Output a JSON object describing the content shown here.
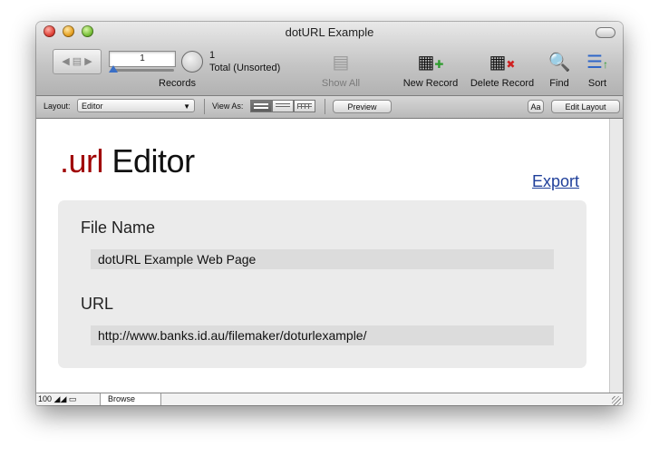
{
  "window": {
    "title": "dotURL Example"
  },
  "toolbar": {
    "record_number": "1",
    "found_count": "1",
    "found_status": "Total (Unsorted)",
    "records_label": "Records",
    "show_all": "Show All",
    "new_record": "New Record",
    "delete_record": "Delete Record",
    "find": "Find",
    "sort": "Sort"
  },
  "layout_bar": {
    "layout_label": "Layout:",
    "layout_value": "Editor",
    "view_as_label": "View As:",
    "preview": "Preview",
    "text_format": "Aa",
    "edit_layout": "Edit Layout"
  },
  "content": {
    "title_accent": ".url",
    "title_rest": " Editor",
    "export_link": "Export",
    "fields": [
      {
        "label": "File Name",
        "value": "dotURL Example Web Page"
      },
      {
        "label": "URL",
        "value": "http://www.banks.id.au/filemaker/doturlexample/"
      }
    ]
  },
  "status_bar": {
    "zoom": "100",
    "mode": "Browse"
  },
  "colors": {
    "accent_red": "#a00000",
    "link_blue": "#1f3f9a"
  },
  "icons": [
    "close-icon",
    "minimize-icon",
    "zoom-icon",
    "book-icon",
    "pie-icon",
    "show-all-icon",
    "new-record-icon",
    "delete-record-icon",
    "find-icon",
    "sort-icon"
  ]
}
